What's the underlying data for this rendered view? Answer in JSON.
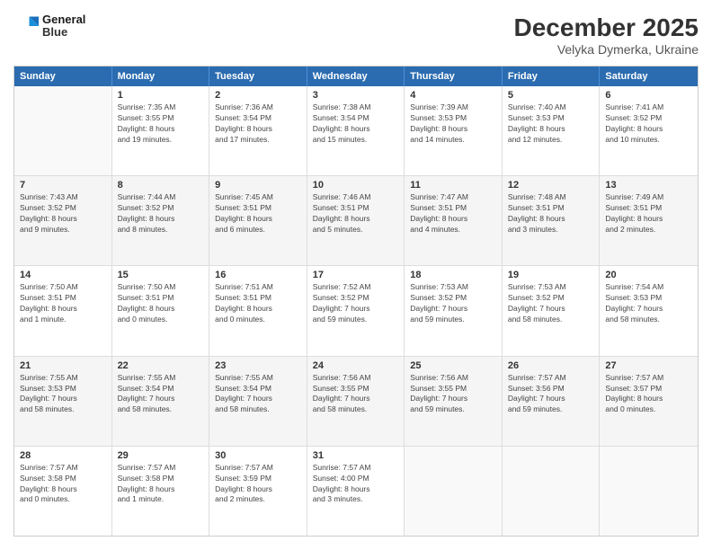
{
  "header": {
    "logo_line1": "General",
    "logo_line2": "Blue",
    "month": "December 2025",
    "location": "Velyka Dymerka, Ukraine"
  },
  "weekdays": [
    "Sunday",
    "Monday",
    "Tuesday",
    "Wednesday",
    "Thursday",
    "Friday",
    "Saturday"
  ],
  "rows": [
    [
      {
        "day": "",
        "text": ""
      },
      {
        "day": "1",
        "text": "Sunrise: 7:35 AM\nSunset: 3:55 PM\nDaylight: 8 hours\nand 19 minutes."
      },
      {
        "day": "2",
        "text": "Sunrise: 7:36 AM\nSunset: 3:54 PM\nDaylight: 8 hours\nand 17 minutes."
      },
      {
        "day": "3",
        "text": "Sunrise: 7:38 AM\nSunset: 3:54 PM\nDaylight: 8 hours\nand 15 minutes."
      },
      {
        "day": "4",
        "text": "Sunrise: 7:39 AM\nSunset: 3:53 PM\nDaylight: 8 hours\nand 14 minutes."
      },
      {
        "day": "5",
        "text": "Sunrise: 7:40 AM\nSunset: 3:53 PM\nDaylight: 8 hours\nand 12 minutes."
      },
      {
        "day": "6",
        "text": "Sunrise: 7:41 AM\nSunset: 3:52 PM\nDaylight: 8 hours\nand 10 minutes."
      }
    ],
    [
      {
        "day": "7",
        "text": "Sunrise: 7:43 AM\nSunset: 3:52 PM\nDaylight: 8 hours\nand 9 minutes."
      },
      {
        "day": "8",
        "text": "Sunrise: 7:44 AM\nSunset: 3:52 PM\nDaylight: 8 hours\nand 8 minutes."
      },
      {
        "day": "9",
        "text": "Sunrise: 7:45 AM\nSunset: 3:51 PM\nDaylight: 8 hours\nand 6 minutes."
      },
      {
        "day": "10",
        "text": "Sunrise: 7:46 AM\nSunset: 3:51 PM\nDaylight: 8 hours\nand 5 minutes."
      },
      {
        "day": "11",
        "text": "Sunrise: 7:47 AM\nSunset: 3:51 PM\nDaylight: 8 hours\nand 4 minutes."
      },
      {
        "day": "12",
        "text": "Sunrise: 7:48 AM\nSunset: 3:51 PM\nDaylight: 8 hours\nand 3 minutes."
      },
      {
        "day": "13",
        "text": "Sunrise: 7:49 AM\nSunset: 3:51 PM\nDaylight: 8 hours\nand 2 minutes."
      }
    ],
    [
      {
        "day": "14",
        "text": "Sunrise: 7:50 AM\nSunset: 3:51 PM\nDaylight: 8 hours\nand 1 minute."
      },
      {
        "day": "15",
        "text": "Sunrise: 7:50 AM\nSunset: 3:51 PM\nDaylight: 8 hours\nand 0 minutes."
      },
      {
        "day": "16",
        "text": "Sunrise: 7:51 AM\nSunset: 3:51 PM\nDaylight: 8 hours\nand 0 minutes."
      },
      {
        "day": "17",
        "text": "Sunrise: 7:52 AM\nSunset: 3:52 PM\nDaylight: 7 hours\nand 59 minutes."
      },
      {
        "day": "18",
        "text": "Sunrise: 7:53 AM\nSunset: 3:52 PM\nDaylight: 7 hours\nand 59 minutes."
      },
      {
        "day": "19",
        "text": "Sunrise: 7:53 AM\nSunset: 3:52 PM\nDaylight: 7 hours\nand 58 minutes."
      },
      {
        "day": "20",
        "text": "Sunrise: 7:54 AM\nSunset: 3:53 PM\nDaylight: 7 hours\nand 58 minutes."
      }
    ],
    [
      {
        "day": "21",
        "text": "Sunrise: 7:55 AM\nSunset: 3:53 PM\nDaylight: 7 hours\nand 58 minutes."
      },
      {
        "day": "22",
        "text": "Sunrise: 7:55 AM\nSunset: 3:54 PM\nDaylight: 7 hours\nand 58 minutes."
      },
      {
        "day": "23",
        "text": "Sunrise: 7:55 AM\nSunset: 3:54 PM\nDaylight: 7 hours\nand 58 minutes."
      },
      {
        "day": "24",
        "text": "Sunrise: 7:56 AM\nSunset: 3:55 PM\nDaylight: 7 hours\nand 58 minutes."
      },
      {
        "day": "25",
        "text": "Sunrise: 7:56 AM\nSunset: 3:55 PM\nDaylight: 7 hours\nand 59 minutes."
      },
      {
        "day": "26",
        "text": "Sunrise: 7:57 AM\nSunset: 3:56 PM\nDaylight: 7 hours\nand 59 minutes."
      },
      {
        "day": "27",
        "text": "Sunrise: 7:57 AM\nSunset: 3:57 PM\nDaylight: 8 hours\nand 0 minutes."
      }
    ],
    [
      {
        "day": "28",
        "text": "Sunrise: 7:57 AM\nSunset: 3:58 PM\nDaylight: 8 hours\nand 0 minutes."
      },
      {
        "day": "29",
        "text": "Sunrise: 7:57 AM\nSunset: 3:58 PM\nDaylight: 8 hours\nand 1 minute."
      },
      {
        "day": "30",
        "text": "Sunrise: 7:57 AM\nSunset: 3:59 PM\nDaylight: 8 hours\nand 2 minutes."
      },
      {
        "day": "31",
        "text": "Sunrise: 7:57 AM\nSunset: 4:00 PM\nDaylight: 8 hours\nand 3 minutes."
      },
      {
        "day": "",
        "text": ""
      },
      {
        "day": "",
        "text": ""
      },
      {
        "day": "",
        "text": ""
      }
    ]
  ]
}
